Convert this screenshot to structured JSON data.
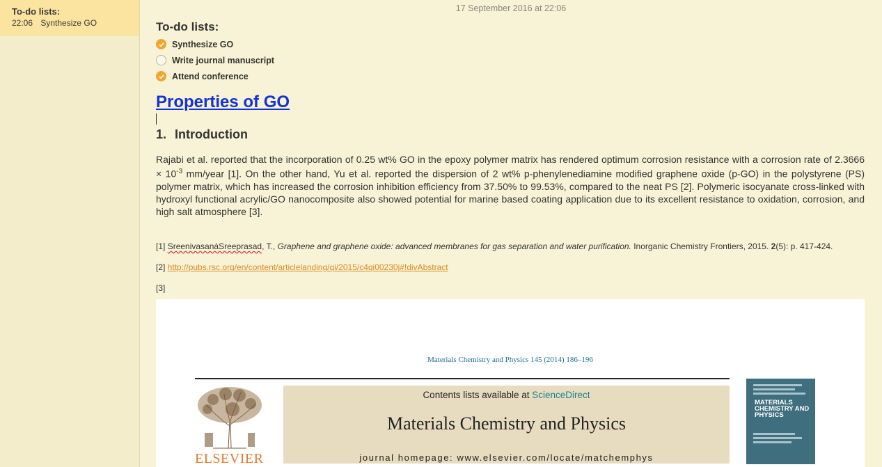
{
  "sidebar": {
    "note": {
      "title": "To-do lists:",
      "time": "22:06",
      "preview": "Synthesize GO"
    }
  },
  "note": {
    "date": "17 September 2016 at 22:06",
    "todo_title": "To-do lists:",
    "todos": [
      {
        "label": "Synthesize GO",
        "done": true
      },
      {
        "label": "Write journal manuscript",
        "done": false
      },
      {
        "label": "Attend conference",
        "done": true
      }
    ],
    "heading_link": "Properties of GO",
    "section_number": "1.",
    "section_title": "Introduction",
    "paragraph": {
      "part1": "Rajabi et al. reported that the incorporation of 0.25 wt% GO in the epoxy polymer matrix has rendered optimum corrosion resistance with a corrosion rate of 2.3666 × 10",
      "exponent": "-3",
      "part2": " mm/year [1]. On the other hand, Yu et al. reported the dispersion of 2 wt% p-phenylenediamine modified graphene oxide (p-GO) in the polystyrene (PS) polymer matrix, which has increased the corrosion inhibition efficiency from 37.50% to 99.53%, compared to the neat PS [2]. Polymeric isocyanate cross-linked with hydroxyl functional acrylic/GO nanocomposite also showed potential for marine based coating application due to its excellent resistance to oxidation, corrosion, and high salt atmosphere [3]."
    },
    "refs": {
      "r1_num": "[1]",
      "r1_author": "SreenivasanáSreeprasad",
      "r1_initial": ", T., ",
      "r1_title": "Graphene and graphene oxide: advanced membranes for gas separation and water purification.",
      "r1_journal": " Inorganic Chemistry Frontiers, 2015. ",
      "r1_volume": "2",
      "r1_pages": "(5): p. 417-424.",
      "r2_num": "[2]",
      "r2_link": "http://pubs.rsc.org/en/content/articlelanding/qi/2015/c4qi00230j#!divAbstract",
      "r3_num": "[3]"
    },
    "embedded_paper": {
      "journal_ref": "Materials Chemistry and Physics 145 (2014) 186–196",
      "available_prefix": "Contents lists available at ",
      "available_link": "ScienceDirect",
      "journal_title": "Materials Chemistry and Physics",
      "homepage": "journal homepage: www.elsevier.com/locate/matchemphys",
      "publisher": "ELSEVIER",
      "cover_title": "MATERIALS CHEMISTRY AND PHYSICS"
    }
  },
  "colors": {
    "accent_check": "#f4a531",
    "link_blue": "#1333d3",
    "link_orange": "#e08a1f",
    "selected_note_bg": "#fbe3a0"
  }
}
